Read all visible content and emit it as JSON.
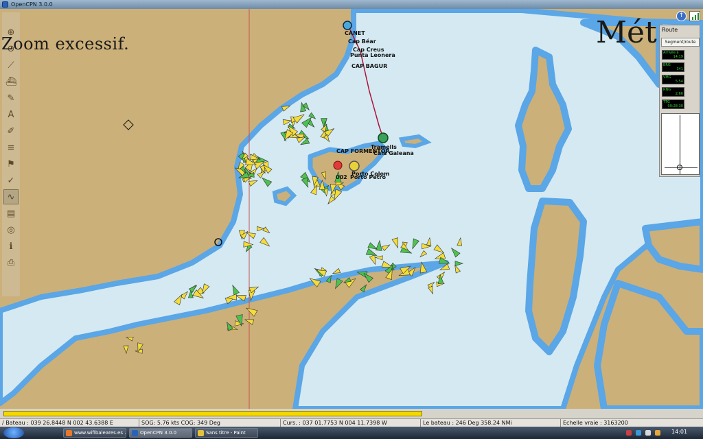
{
  "window": {
    "title": "OpenCPN 3.0.0"
  },
  "overlay": {
    "zoom_message": "Zoom excessif.",
    "meteo_label": "Mét"
  },
  "colors": {
    "land": "#cbb07a",
    "shallow_water": "#5aa6e6",
    "deep_water": "#d4e9f1",
    "route": "#b0123a",
    "vessel_yellow": "#f4dc3a",
    "vessel_green": "#4ec24e"
  },
  "toolbar": {
    "icons": [
      "zoom-in-icon",
      "zoom-out-icon",
      "route-icon",
      "ship-icon",
      "measure-icon",
      "text-icon",
      "brush-icon",
      "layers-icon",
      "waypoint-icon",
      "settings-icon",
      "track-icon",
      "chart-icon",
      "lifebuoy-icon",
      "info-icon",
      "print-icon"
    ]
  },
  "chart_labels": [
    {
      "id": "canet",
      "text": "CANET"
    },
    {
      "id": "bear",
      "text": "Cap Béar"
    },
    {
      "id": "creus",
      "text": "Cap Creus"
    },
    {
      "id": "leonera",
      "text": "Punta Leonera"
    },
    {
      "id": "bagur",
      "text": "CAP BAGUR"
    },
    {
      "id": "formentor",
      "text": "CAP FORMENTOR"
    },
    {
      "id": "tramells",
      "text": "Tramells"
    },
    {
      "id": "galeana",
      "text": "Cala Galeana"
    },
    {
      "id": "colom",
      "text": "Porto Colom"
    },
    {
      "id": "petro",
      "text": "Porto Petro"
    },
    {
      "id": "wp",
      "text": "002"
    }
  ],
  "dashboard": {
    "title": "Route",
    "button_label": "Segment/route",
    "instruments": [
      {
        "key": "Arrivée à",
        "value": "14:19"
      },
      {
        "key": "BRG",
        "value": "341"
      },
      {
        "key": "VMG",
        "value": "5.54"
      },
      {
        "key": "RNG",
        "value": "2.66"
      },
      {
        "key": "TTG",
        "value": "00:28:30"
      }
    ]
  },
  "status": {
    "progress": 1.0,
    "boat_position": "/ Bateau : 039 26.8448 N   002 43.6388 E",
    "sog_cog": "SOG:  5.76 kts  COG:  349 Deg",
    "cursor": "Curs. : 037 01.7753 N 004 11.7398 W",
    "bearing": "Le bateau : 246 Deg  358.24 NMi",
    "scale": "Echelle vraie :  3163200"
  },
  "taskbar": {
    "tasks": [
      {
        "label": "www.wifibaleares.es ...",
        "color": "#e8792a"
      },
      {
        "label": "OpenCPN 3.0.0",
        "color": "#2a62b8"
      },
      {
        "label": "Sans titre - Paint",
        "color": "#e3c23a"
      }
    ],
    "clock": "14:01"
  }
}
